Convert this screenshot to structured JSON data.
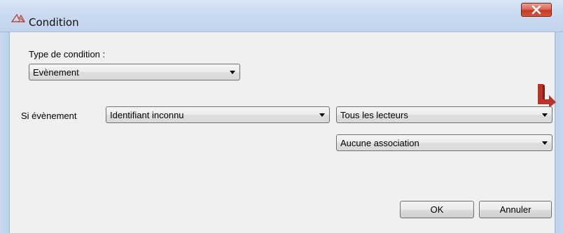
{
  "window": {
    "title": "Condition",
    "icons": {
      "app": "condition-icon",
      "close": "close-icon",
      "logo": "arrow-logo-icon"
    },
    "colors": {
      "accent": "#b8332a",
      "close_button": "#c23b22"
    }
  },
  "form": {
    "type_label": "Type de condition :",
    "type_value": "Evènement",
    "event_label": "Si évènement",
    "event_value": "Identifiant inconnu",
    "reader_value": "Tous les lecteurs",
    "association_value": "Aucune association"
  },
  "buttons": {
    "ok": "OK",
    "cancel": "Annuler"
  }
}
